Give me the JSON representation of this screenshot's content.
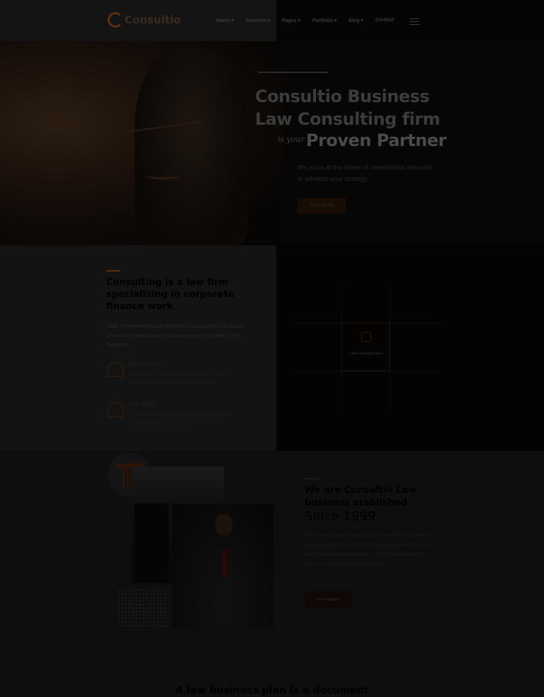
{
  "header": {
    "logo_text": "Consultio",
    "nav": {
      "home": "Home ▾",
      "services": "Services ▾",
      "pages": "Pages ▾",
      "portfolio": "Portfolio ▾",
      "blog": "Blog ▾",
      "contact": "Contact"
    }
  },
  "hero": {
    "title": "Consultio Business Law Consulting firm",
    "subtitle_prefix": "is your",
    "title_emphasis": "Proven Partner",
    "description": "We poice at the centre of international networks to advance your strategy.",
    "cta_label": "Get in touch"
  },
  "about": {
    "title": "Consulting is a law firm specialising in corporate finance work",
    "text": "Advice of transformation legal solutions and legal planning on all aspects of business, including issues under Company Law & Exchange Control Regulations.",
    "mission_title": "Our Mission",
    "mission_text": "Business Law Consulting LLC is every kind of law firm. We are driven to be the best business law firm.",
    "value_title": "Our Value",
    "value_text": "A clear view has all that we evident focus we are. Get the value we are the world say.",
    "active_service": "Law management"
  },
  "established": {
    "title": "We are Consultio Law business stablished",
    "since": "Since 1999.",
    "text": "When creating Bowers Business Law Consulting PLC, the attorney client relationship was reversed directly keeping need the services. Now to provide quality legal services to clients without having the billable hour be a barrier to the legal services.",
    "cta_label": "More details"
  },
  "bottom": {
    "title": "A law business plan is a document"
  }
}
